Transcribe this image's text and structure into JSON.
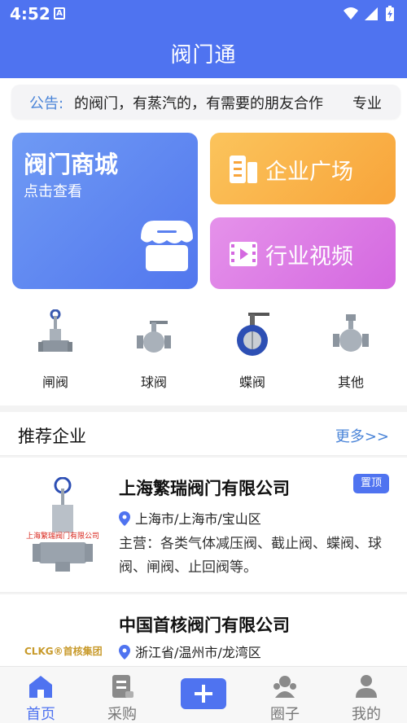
{
  "status_bar": {
    "time": "4:52",
    "a_badge": "A"
  },
  "header": {
    "title": "阀门通"
  },
  "notice": {
    "label": "公告:",
    "text": "的阀门，有蒸汽的，有需要的朋友合作　　专业"
  },
  "cards": {
    "mall": {
      "title": "阀门商城",
      "subtitle": "点击查看"
    },
    "enterprise": {
      "label": "企业广场"
    },
    "video": {
      "label": "行业视频"
    }
  },
  "categories": [
    {
      "label": "闸阀",
      "icon": "gate-valve-icon"
    },
    {
      "label": "球阀",
      "icon": "ball-valve-icon"
    },
    {
      "label": "蝶阀",
      "icon": "butterfly-valve-icon"
    },
    {
      "label": "其他",
      "icon": "other-valve-icon"
    }
  ],
  "section": {
    "title": "推荐企业",
    "more": "更多>>"
  },
  "companies": [
    {
      "name": "上海繁瑞阀门有限公司",
      "badge": "置顶",
      "location": "上海市/上海市/宝山区",
      "description": "主营：各类气体减压阀、截止阀、蝶阀、球阀、闸阀、止回阀等。",
      "logo_text": "上海繁瑞阀门有限公司"
    },
    {
      "name": "中国首核阀门有限公司",
      "location": "浙江省/温州市/龙湾区",
      "logo_text": "CLKG®首核集团"
    }
  ],
  "bottom_nav": {
    "home": "首页",
    "purchase": "采购",
    "circle": "圈子",
    "mine": "我的"
  },
  "colors": {
    "primary": "#4f73f0",
    "link": "#4a84d8",
    "orange": "#f8a43a",
    "purple": "#d468e0"
  }
}
